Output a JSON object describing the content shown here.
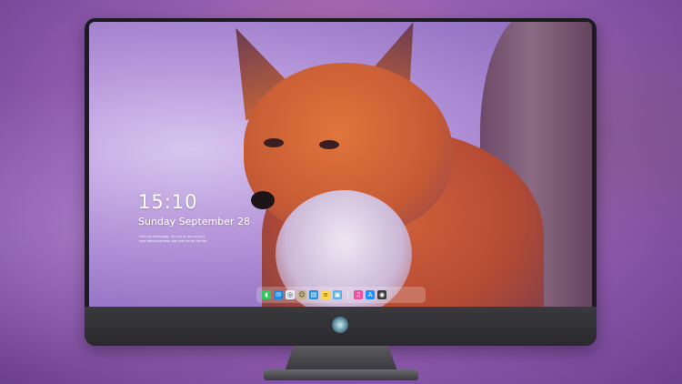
{
  "lockscreen": {
    "time": "15:10",
    "date": "Sunday September 28",
    "note_line1": "Hello my technology, it's nice to see you at it",
    "note_line2": "your latest programs, stay with me for the day"
  },
  "dock": {
    "apps": [
      {
        "name": "messages",
        "icon": "messages-icon",
        "color": "#34c759"
      },
      {
        "name": "mail",
        "icon": "mail-icon",
        "color": "#1e88e5"
      },
      {
        "name": "safari",
        "icon": "compass-icon",
        "color": "#e8eef6"
      },
      {
        "name": "finder",
        "icon": "finder-icon",
        "color": "#c8b48a"
      },
      {
        "name": "claquette",
        "icon": "clapperboard-icon",
        "color": "#2a8fd6"
      },
      {
        "name": "notes",
        "icon": "notes-icon",
        "color": "#ffd54a"
      },
      {
        "name": "preview",
        "icon": "photo-icon",
        "color": "#5fb0e0"
      },
      {
        "name": "music",
        "icon": "music-icon",
        "color": "#f0509a"
      },
      {
        "name": "app-store",
        "icon": "app-store-icon",
        "color": "#1e90ff"
      },
      {
        "name": "camera",
        "icon": "camera-icon",
        "color": "#3a3a3a"
      }
    ]
  },
  "colors": {
    "wallpaper_tint": "#b99bdc",
    "fox_fur": "#c65a34",
    "monitor_frame": "#1c1c1f"
  }
}
